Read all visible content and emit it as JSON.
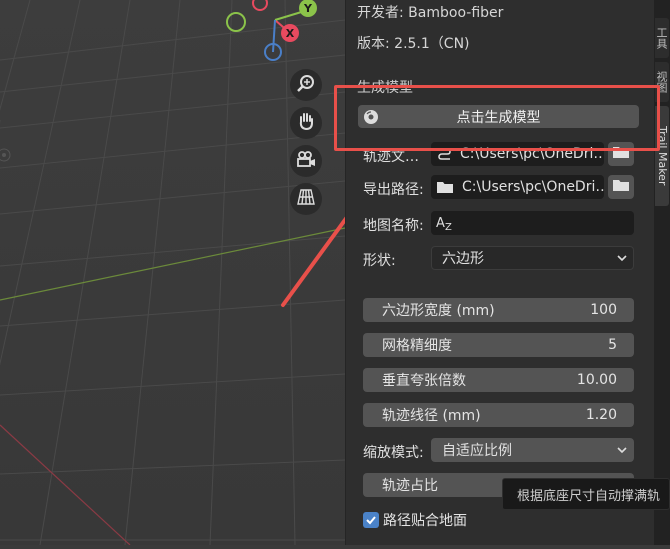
{
  "panel": {
    "developer": "开发者: Bamboo-fiber",
    "version": "版本: 2.5.1（CN)",
    "generate_section": "生成模型",
    "generate_button": "点击生成模型",
    "track_file_label": "轨迹文…",
    "track_file_value": "C:\\Users\\pc\\OneDri…",
    "export_path_label": "导出路径:",
    "export_path_value": "C:\\Users\\pc\\OneDri…",
    "map_name_label": "地图名称:",
    "map_name_value": "",
    "shape_label": "形状:",
    "shape_value": "六边形",
    "hex_width_label": "六边形宽度 (mm)",
    "hex_width_value": "100",
    "grid_fineness_label": "网格精细度",
    "grid_fineness_value": "5",
    "vertical_exaggeration_label": "垂直夸张倍数",
    "vertical_exaggeration_value": "10.00",
    "track_width_label": "轨迹线径 (mm)",
    "track_width_value": "1.20",
    "scale_mode_label": "缩放模式:",
    "scale_mode_value": "自适应比例",
    "track_ratio_label": "轨迹占比",
    "snap_to_ground_label": "路径贴合地面",
    "snap_to_ground_checked": true
  },
  "tooltip": "根据底座尺寸自动撑满轨",
  "side_tabs": [
    "工具",
    "视图",
    "Trail Maker"
  ],
  "gizmo": {
    "y_label": "Y",
    "x_label": "X"
  },
  "colors": {
    "accent": "#e8504a",
    "checkbox": "#4a82c8",
    "x_axis": "#e84a5f",
    "y_axis": "#8bc34a",
    "z_axis": "#4a7fc8"
  }
}
